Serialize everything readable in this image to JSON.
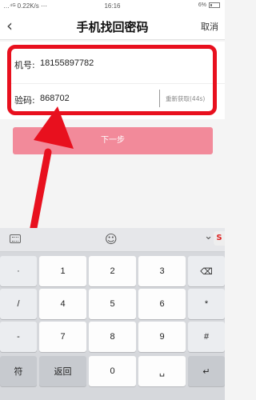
{
  "status": {
    "left": "…⁴ᴳ 0.22K/s ⋯",
    "time": "16:16",
    "battery": "6%"
  },
  "header": {
    "back_icon": "back-chevron-icon",
    "title": "手机找回密码",
    "cancel": "取消"
  },
  "form": {
    "phone": {
      "label": "机号:",
      "value": "18155897782"
    },
    "code": {
      "label": "验码:",
      "value": "868702",
      "resend": "重新获取(44s)"
    }
  },
  "next_button": "下一步",
  "annotation": {
    "highlight_color": "#e8101e"
  },
  "keyboard": {
    "side_keys": [
      "·",
      "/",
      "+",
      "-"
    ],
    "digits": [
      "1",
      "2",
      "3",
      "4",
      "5",
      "6",
      "7",
      "8",
      "9"
    ],
    "right_keys": [
      "⌫",
      "*",
      "#"
    ],
    "bottom": {
      "symbols": "符",
      "back": "返回",
      "zero": "0",
      "space": "␣",
      "enter": "↵"
    }
  }
}
